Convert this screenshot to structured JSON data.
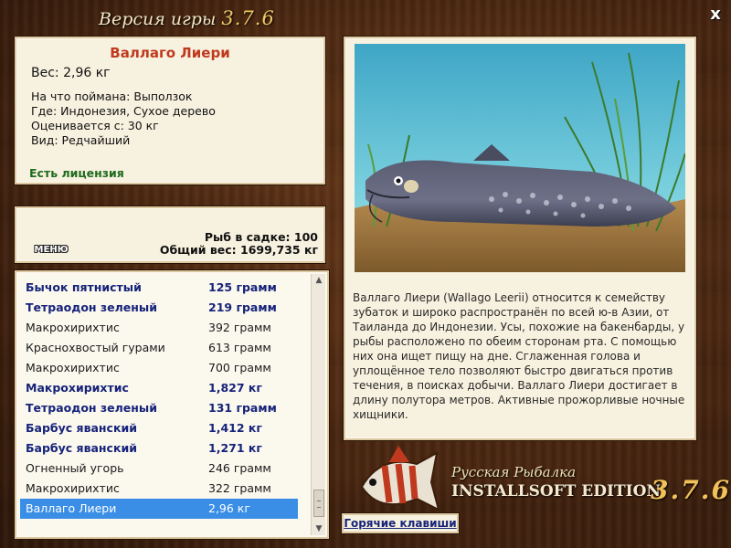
{
  "window": {
    "title_prefix": "Версия игры",
    "title_version": "3.7.6",
    "close_label": "x"
  },
  "catch": {
    "fish_name": "Валлаго Лиери",
    "weight": "Вес: 2,96 кг",
    "caught_on": "На что поймана: Выползок",
    "location": "Где: Индонезия, Сухое дерево",
    "value": "Оценивается с: 30 кг",
    "rarity": "Вид: Редчайший",
    "license": "Есть лицензия"
  },
  "cage": {
    "menu_label": "МЕНЮ",
    "count": "Рыб в садке: 100",
    "total_weight": "Общий вес: 1699,735 кг"
  },
  "fish_list": {
    "items": [
      {
        "name": "Бычок пятнистый",
        "weight": "125 грамм",
        "bold": true
      },
      {
        "name": "Тетраодон зеленый",
        "weight": "219 грамм",
        "bold": true
      },
      {
        "name": "Макрохирихтис",
        "weight": "392 грамм",
        "bold": false
      },
      {
        "name": "Краснохвостый гурами",
        "weight": "613 грамм",
        "bold": false
      },
      {
        "name": "Макрохирихтис",
        "weight": "700 грамм",
        "bold": false
      },
      {
        "name": "Макрохирихтис",
        "weight": "1,827 кг",
        "bold": true
      },
      {
        "name": "Тетраодон зеленый",
        "weight": "131 грамм",
        "bold": true
      },
      {
        "name": "Барбус яванский",
        "weight": "1,412 кг",
        "bold": true
      },
      {
        "name": "Барбус яванский",
        "weight": "1,271 кг",
        "bold": true
      },
      {
        "name": "Огненный угорь",
        "weight": "246 грамм",
        "bold": false
      },
      {
        "name": "Макрохирихтис",
        "weight": "322 грамм",
        "bold": false
      },
      {
        "name": "Валлаго Лиери",
        "weight": "2,96 кг",
        "bold": false,
        "selected": true
      }
    ],
    "scroll_position": 0.9
  },
  "description": {
    "text": "Валлаго Лиери (Wallago Leerii) относится к семейству зубаток и широко распространён по всей ю-в Азии, от Таиланда до Индонезии. Усы, похожие на бакенбарды, у рыбы расположено по обеим сторонам рта. С помощью них она ищет пищу на дне. Сглаженная голова и уплощённое тело позволяют быстро двигаться против течения, в поисках добычи. Валлаго Лиери достигает в длину полутора метров. Активные прожорливые ночные хищники."
  },
  "branding": {
    "brand": "Русская Рыбалка",
    "edition": "INSTALLSOFT EDITION",
    "version": "3.7.6"
  },
  "hotkeys_label": "Горячие клавиши",
  "colors": {
    "accent_name": "#c0391f",
    "list_bold": "#16237a",
    "selection": "#3a8ee6",
    "license": "#1e6b1e",
    "panel_bg": "#f7f1df"
  }
}
